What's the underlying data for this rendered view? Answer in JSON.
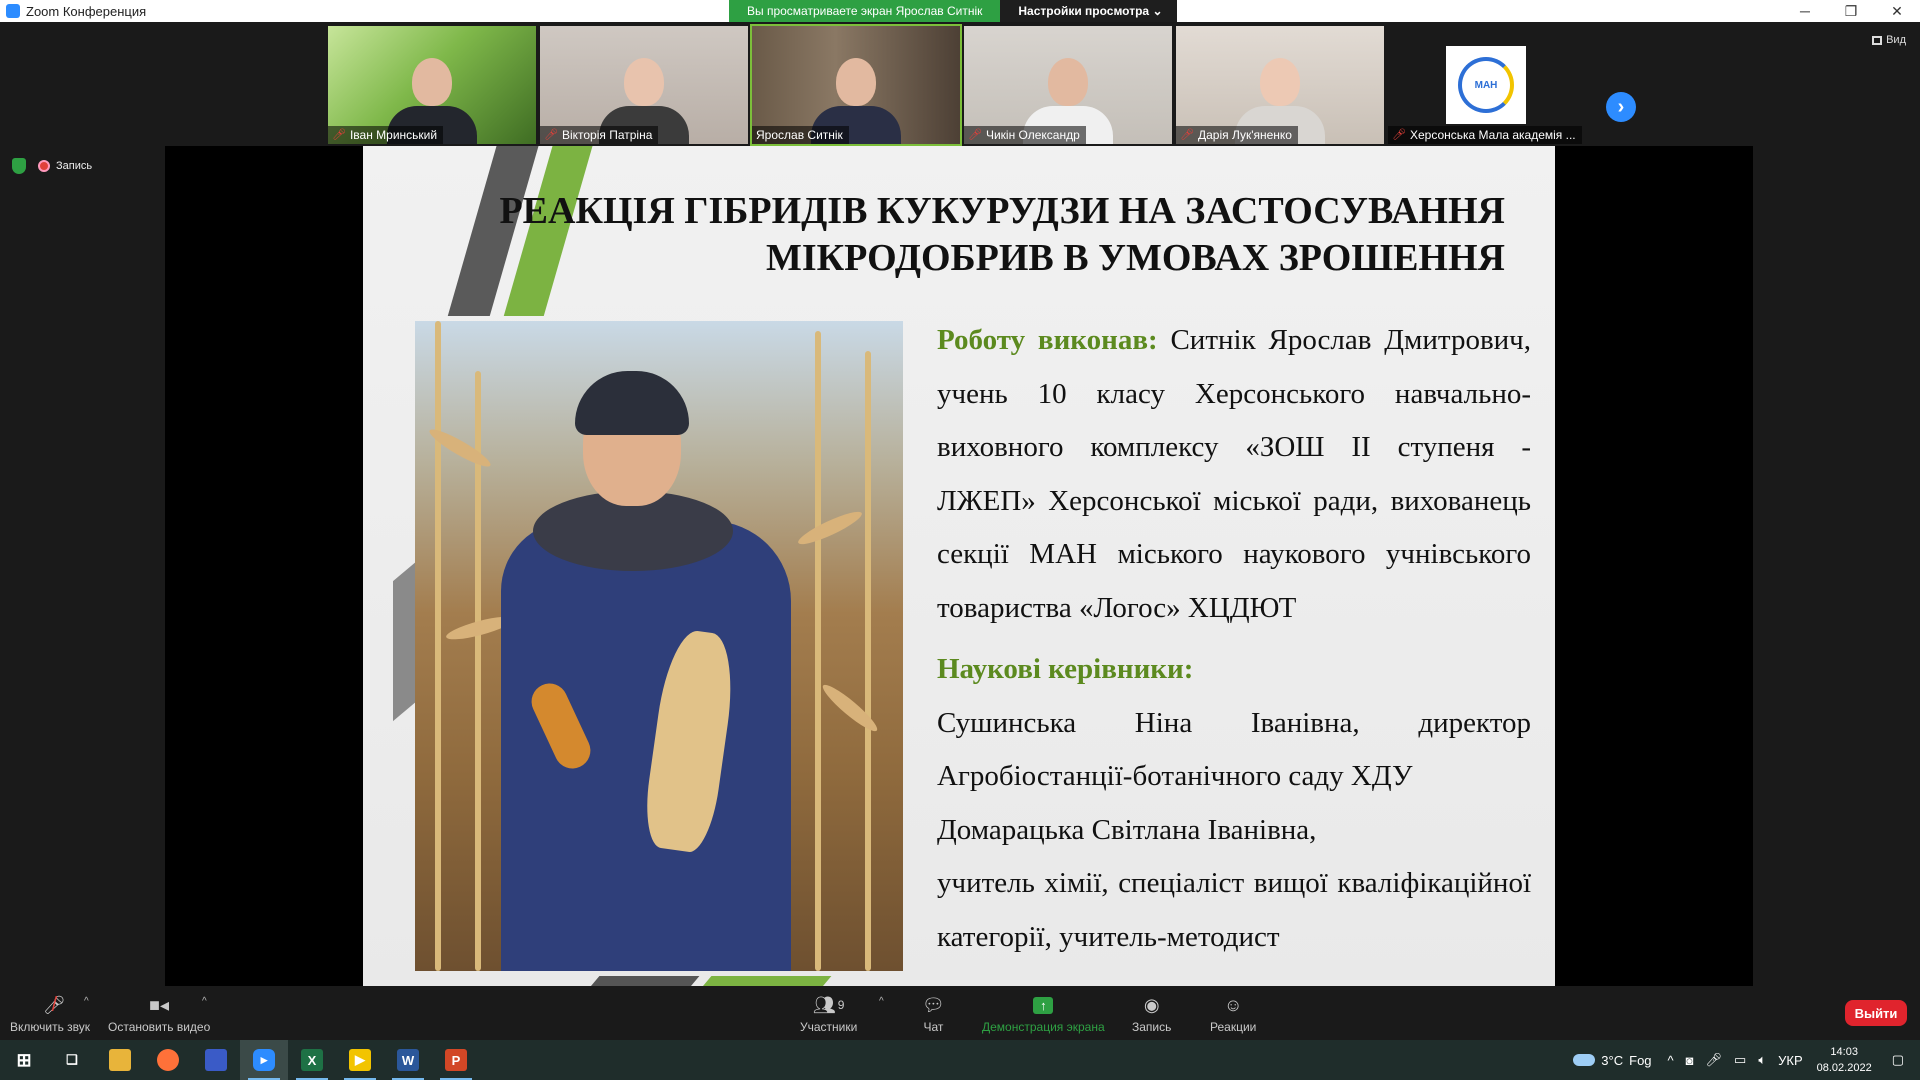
{
  "window": {
    "title": "Zoom Конференция",
    "share_banner": "Вы просматриваете экран Ярослав Ситнік",
    "view_options": "Настройки просмотра",
    "controls": [
      "─",
      "❐",
      "✕"
    ]
  },
  "participants": [
    {
      "name": "Іван Мринський",
      "muted": true
    },
    {
      "name": "Вікторія Патріна",
      "muted": true
    },
    {
      "name": "Ярослав Ситнік",
      "muted": false,
      "active": true
    },
    {
      "name": "Чикін Олександр",
      "muted": true
    },
    {
      "name": "Дарія Лук'яненко",
      "muted": true
    },
    {
      "name": "Херсонська Мала академія ...",
      "muted": true,
      "logo_text": "МАН"
    }
  ],
  "view_button": "Вид",
  "recording_label": "Запись",
  "slide": {
    "title_line1": "РЕАКЦІЯ ГІБРИДІВ КУКУРУДЗИ НА ЗАСТОСУВАННЯ",
    "title_line2": "МІКРОДОБРИВ В УМОВАХ ЗРОШЕННЯ",
    "author_label": "Роботу виконав:",
    "author_text": " Ситнік Ярослав Дмитрович, учень 10 класу Херсонського навчально-виховного комплексу «ЗОШ ІІ ступеня - ЛЖЕП» Херсонської міської ради, вихованець секції МАН міського наукового учнівського товариства «Логос» ХЦДЮТ",
    "supervisors_label": "Наукові керівники:",
    "supervisor1": "Сушинська Ніна Іванівна, директор Агробіостанції-ботанічного саду ХДУ",
    "supervisor2_name": "Домарацька Світлана Іванівна,",
    "supervisor2_role": "учитель хімії, спеціаліст вищої кваліфікаційної категорії, учитель-методист"
  },
  "toolbar": {
    "unmute": "Включить звук",
    "stop_video": "Остановить видео",
    "participants": "Участники",
    "participants_count": "9",
    "chat": "Чат",
    "share_screen": "Демонстрация экрана",
    "record": "Запись",
    "reactions": "Реакции",
    "leave": "Выйти"
  },
  "taskbar": {
    "temperature": "3°C",
    "weather": "Fog",
    "language": "УКР",
    "time": "14:03",
    "date": "08.02.2022"
  },
  "colors": {
    "zoom_blue": "#2d8cff",
    "share_green": "#2ea043",
    "slide_green": "#5c8a1f",
    "leave_red": "#e0242d"
  }
}
